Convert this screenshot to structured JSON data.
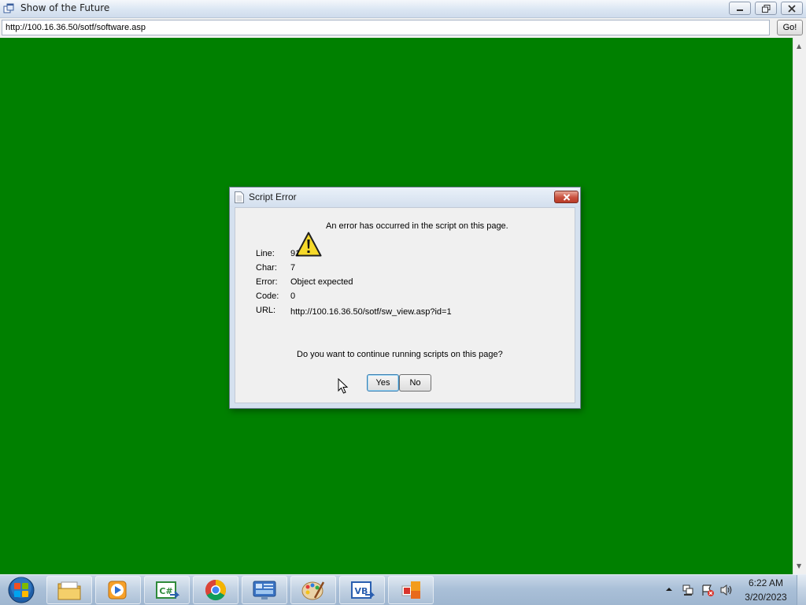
{
  "window": {
    "title": "Show of the Future",
    "icon": "app-window-icon",
    "controls": [
      "minimize-icon",
      "restore-icon",
      "close-icon"
    ]
  },
  "address_bar": {
    "url": "http://100.16.36.50/sotf/software.asp",
    "go_label": "Go!"
  },
  "content": {
    "background_color": "#008000"
  },
  "dialog": {
    "title": "Script Error",
    "message": "An error has occurred in the script on this page.",
    "details": [
      {
        "label": "Line:",
        "value": "91"
      },
      {
        "label": "Char:",
        "value": "7"
      },
      {
        "label": "Error:",
        "value": "Object expected"
      },
      {
        "label": "Code:",
        "value": "0"
      },
      {
        "label": "URL:",
        "value": "http://100.16.36.50/sotf/sw_view.asp?id=1"
      }
    ],
    "question": "Do you want to continue running scripts on this page?",
    "yes_label": "Yes",
    "no_label": "No"
  },
  "taskbar": {
    "pinned": [
      {
        "name": "windows-explorer-icon"
      },
      {
        "name": "media-player-icon"
      },
      {
        "name": "csharp-express-icon"
      },
      {
        "name": "chrome-icon"
      },
      {
        "name": "remote-desktop-icon"
      },
      {
        "name": "paint-icon"
      },
      {
        "name": "visual-basic-express-icon"
      },
      {
        "name": "office-icon"
      }
    ],
    "clock": {
      "time": "6:22 AM",
      "date": "3/20/2023"
    }
  }
}
